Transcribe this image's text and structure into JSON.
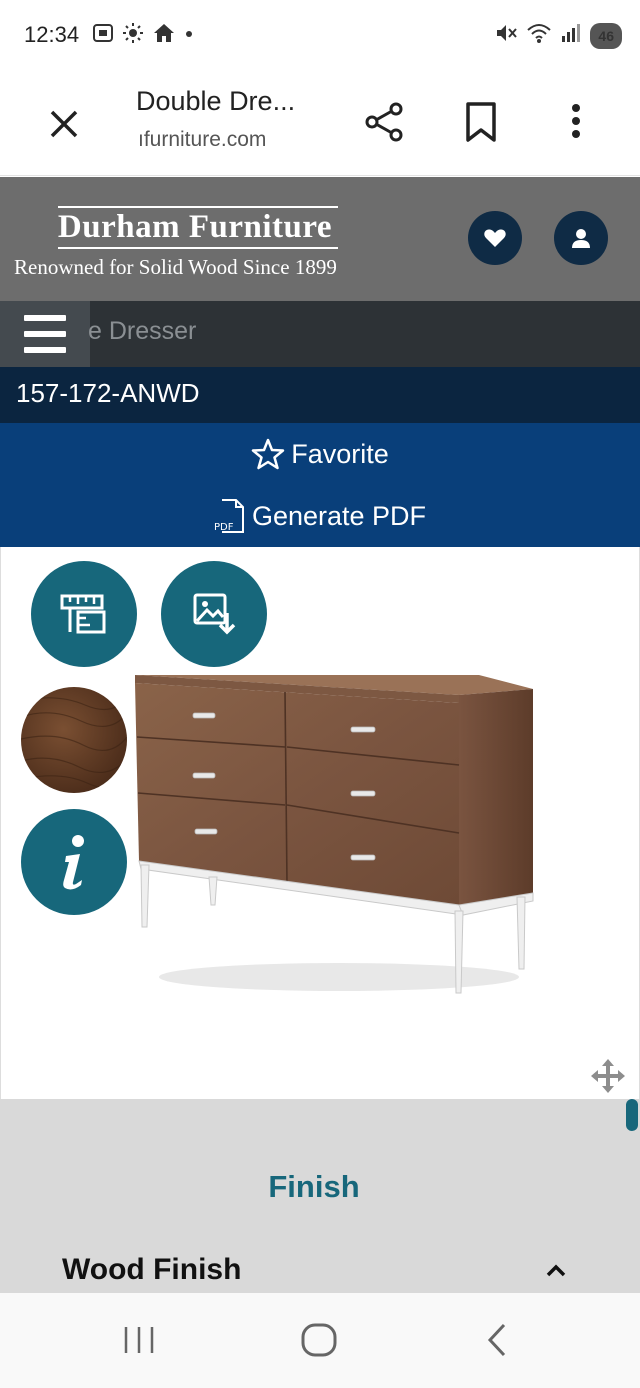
{
  "status_bar": {
    "time": "12:34",
    "left_icons": [
      "screenshot-icon",
      "brightness-icon",
      "home-icon",
      "dot-icon"
    ],
    "right_icons": [
      "mute-icon",
      "wifi-icon",
      "signal-icon"
    ],
    "battery": "46"
  },
  "browser": {
    "page_title": "Double Dre...",
    "domain": "ıfurniture.com"
  },
  "site_header": {
    "brand_name": "Durham Furniture",
    "tagline": "Renowned for Solid Wood Since 1899"
  },
  "nav": {
    "title": "e Dresser"
  },
  "product": {
    "sku": "157-172-ANWD",
    "favorite_label": "Favorite",
    "pdf_badge": "PDF",
    "generate_pdf_label": "Generate PDF",
    "swatch_color": "#5a3520",
    "accent_color": "#17677b"
  },
  "finish_panel": {
    "title": "Finish",
    "wood_finish_label": "Wood Finish"
  },
  "colors": {
    "header_gray": "#6d6d6d",
    "nav_dark": "#2d3236",
    "sku_navy": "#0b2540",
    "action_blue": "#093f7a",
    "icon_navy": "#0f2b45",
    "teal": "#17677b"
  }
}
